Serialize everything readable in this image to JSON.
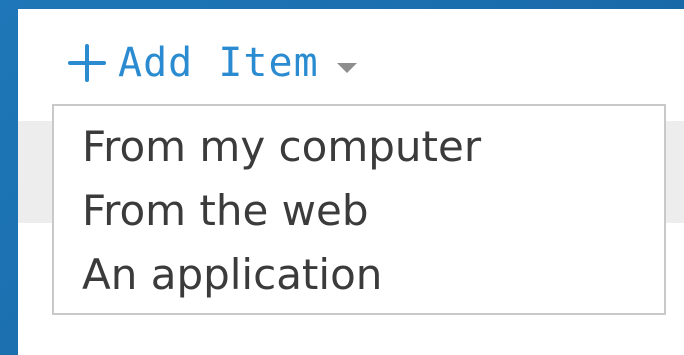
{
  "add_item": {
    "label": "Add Item",
    "icon": "plus-icon",
    "dropdown_icon": "chevron-down-icon",
    "accent_color": "#2a8bd0"
  },
  "menu": {
    "items": [
      {
        "label": "From my computer"
      },
      {
        "label": "From the web"
      },
      {
        "label": "An application"
      }
    ]
  },
  "colors": {
    "frame_blue": "#1c73b3",
    "menu_border": "#c9c9c9",
    "menu_text": "#3b3b3b"
  }
}
